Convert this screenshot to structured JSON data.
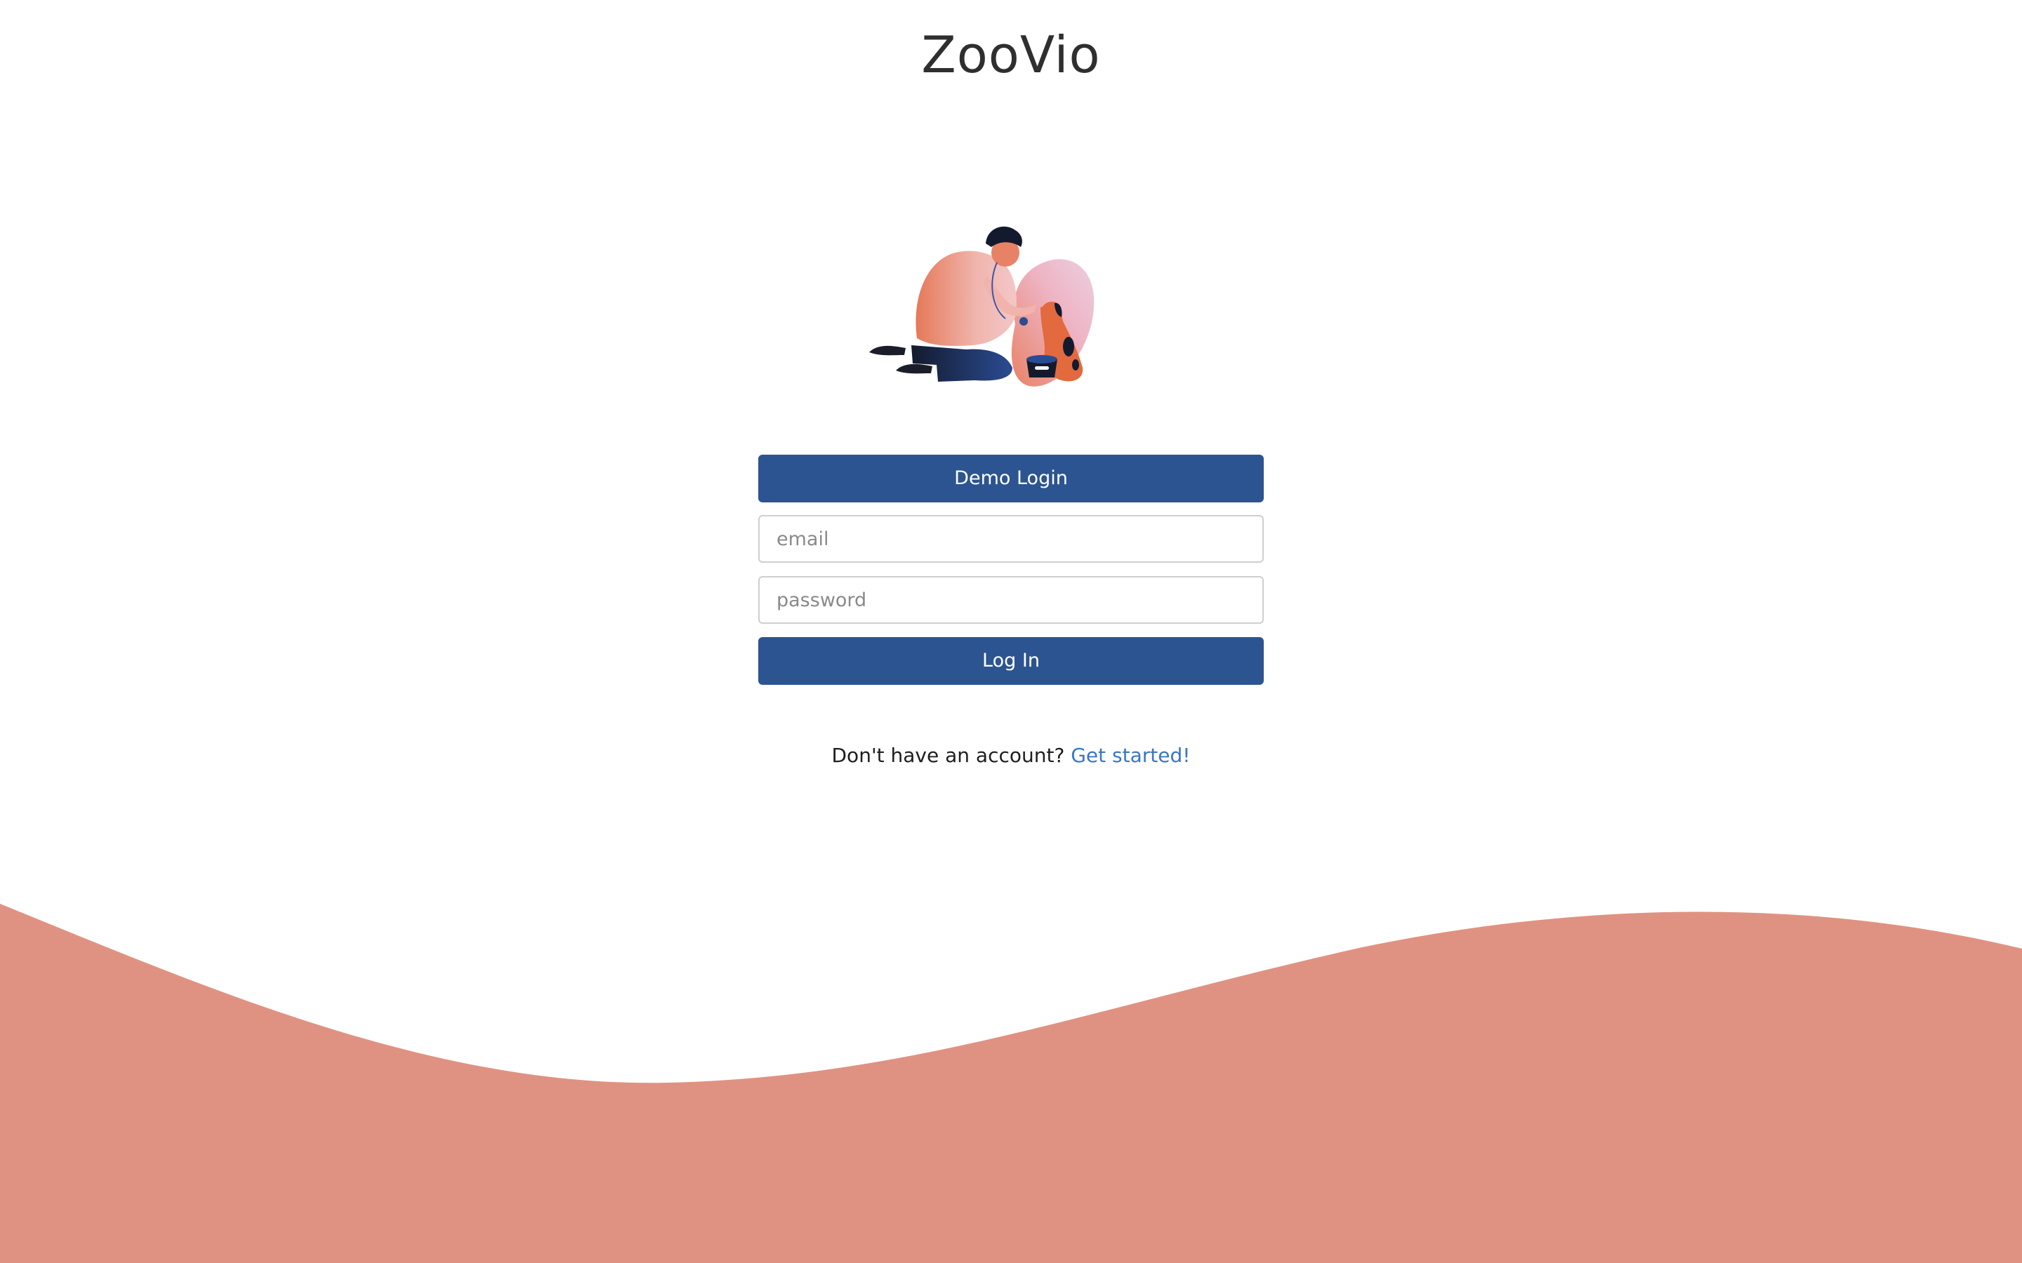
{
  "header": {
    "app_title": "ZooVio"
  },
  "hero": {
    "illustration": "vet-with-dog-illustration"
  },
  "login_form": {
    "demo_button_label": "Demo Login",
    "email_placeholder": "email",
    "email_value": "",
    "password_placeholder": "password",
    "password_value": "",
    "login_button_label": "Log In"
  },
  "signup": {
    "prompt_text": "Don't have an account? ",
    "link_text": "Get started!"
  },
  "colors": {
    "primary_button": "#2c5490",
    "link": "#3a77c2",
    "wave": "#e09282"
  }
}
